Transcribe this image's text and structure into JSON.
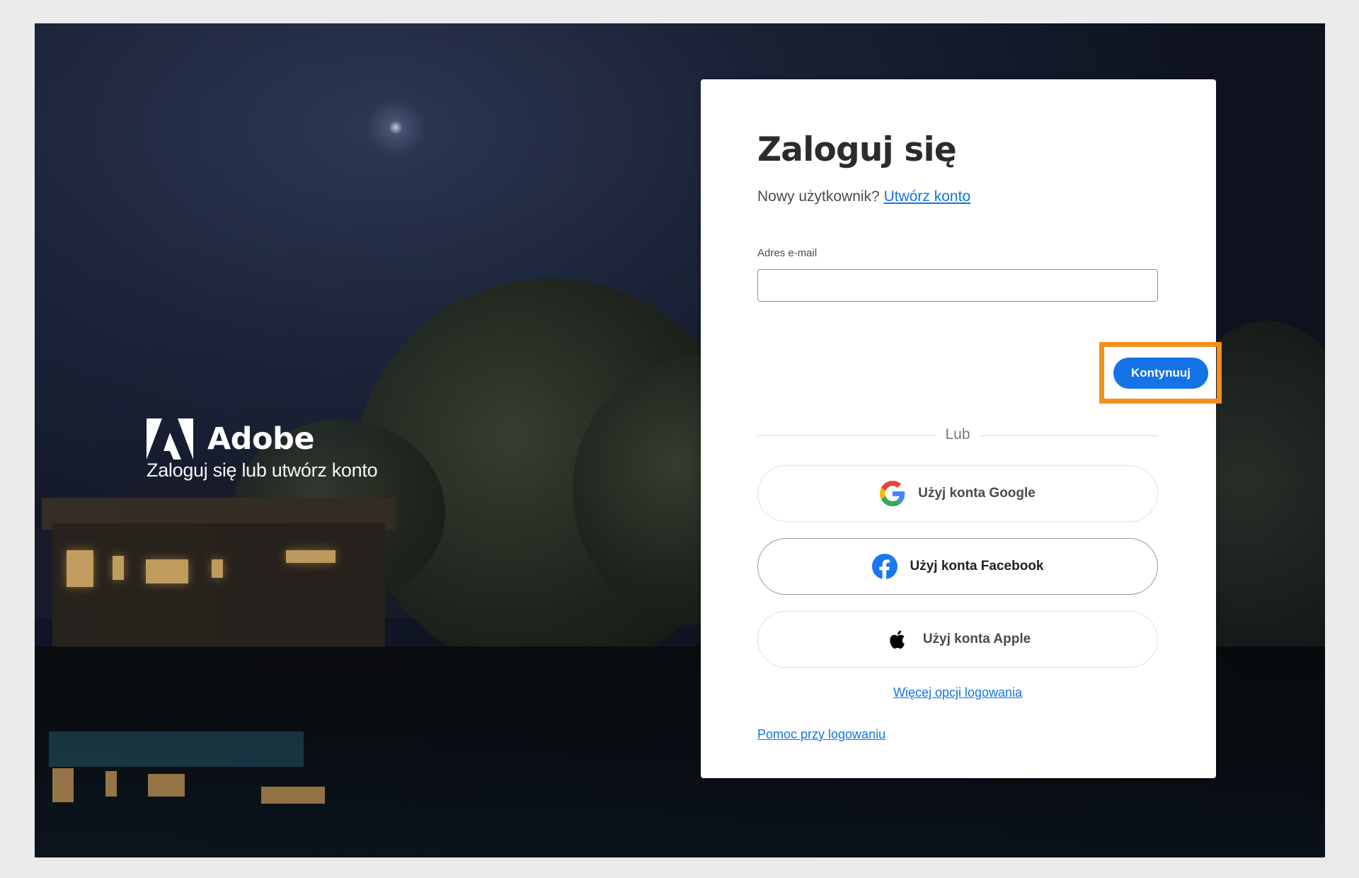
{
  "brand": {
    "name": "Adobe",
    "tagline": "Zaloguj się lub utwórz konto",
    "logo_icon": "adobe-logo-icon"
  },
  "login": {
    "title": "Zaloguj się",
    "new_user_text": "Nowy użytkownik?",
    "create_account_link": "Utwórz konto",
    "email_label": "Adres e-mail",
    "email_value": "",
    "continue_label": "Kontynuuj",
    "divider_text": "Lub",
    "social": [
      {
        "label": "Użyj konta Google",
        "icon": "google-icon"
      },
      {
        "label": "Użyj konta Facebook",
        "icon": "facebook-icon"
      },
      {
        "label": "Użyj konta Apple",
        "icon": "apple-icon"
      }
    ],
    "more_options_link": "Więcej opcji logowania",
    "help_link": "Pomoc przy logowaniu"
  },
  "colors": {
    "accent": "#1473e6",
    "highlight": "#f3901d",
    "facebook": "#1877f2"
  }
}
